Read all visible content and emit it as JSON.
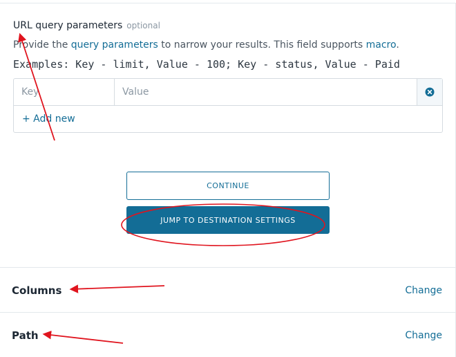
{
  "url_params": {
    "title": "URL query parameters",
    "optional_label": "optional",
    "desc_prefix": "Provide the ",
    "desc_link1": "query parameters",
    "desc_middle": " to narrow your results. This field supports ",
    "desc_link2": "macro",
    "desc_suffix": ".",
    "examples": "Examples: Key - limit, Value - 100; Key - status, Value - Paid",
    "key_placeholder": "Key",
    "value_placeholder": "Value",
    "key_value": "",
    "value_value": "",
    "add_new_label": "+ Add new"
  },
  "buttons": {
    "continue_label": "CONTINUE",
    "jump_label": "JUMP TO DESTINATION SETTINGS"
  },
  "sections": {
    "columns_title": "Columns",
    "columns_change": "Change",
    "path_title": "Path",
    "path_change": "Change"
  },
  "colors": {
    "accent": "#136d96",
    "annotation": "#e0141e"
  }
}
